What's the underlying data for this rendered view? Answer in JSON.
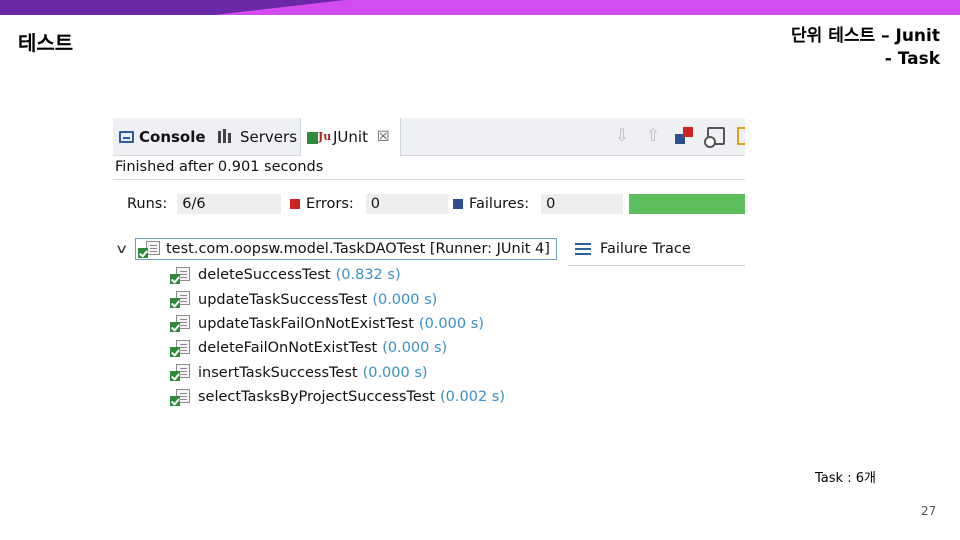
{
  "slide": {
    "title": "테스트",
    "subtitle_line1": "단위 테스트 – Junit",
    "subtitle_line2": "- Task",
    "note": "Task : 6개",
    "page_number": "27"
  },
  "tabs": [
    {
      "label": "Console",
      "icon": "console-icon"
    },
    {
      "label": "Servers",
      "icon": "servers-icon"
    },
    {
      "label": "JUnit",
      "icon": "junit-icon",
      "active": true
    }
  ],
  "status": {
    "finished": "Finished after 0.901 seconds"
  },
  "counters": {
    "runs_label": "Runs:",
    "runs_value": "6/6",
    "errors_label": "Errors:",
    "errors_value": "0",
    "failures_label": "Failures:",
    "failures_value": "0",
    "progress_fraction": 1.0
  },
  "colors": {
    "progress": "#5cbd5c",
    "test_time": "#3b8fc4",
    "banner": "#d34cf0",
    "banner_dark": "#6c27a6"
  },
  "tree": {
    "root_label": "test.com.oopsw.model.TaskDAOTest [Runner: JUnit 4]",
    "failure_trace_label": "Failure Trace",
    "tests": [
      {
        "name": "deleteSuccessTest",
        "time": "(0.832 s)"
      },
      {
        "name": "updateTaskSuccessTest",
        "time": "(0.000 s)"
      },
      {
        "name": "updateTaskFailOnNotExistTest",
        "time": "(0.000 s)"
      },
      {
        "name": "deleteFailOnNotExistTest",
        "time": "(0.000 s)"
      },
      {
        "name": "insertTaskSuccessTest",
        "time": "(0.000 s)"
      },
      {
        "name": "selectTasksByProjectSuccessTest",
        "time": "(0.002 s)"
      }
    ]
  }
}
